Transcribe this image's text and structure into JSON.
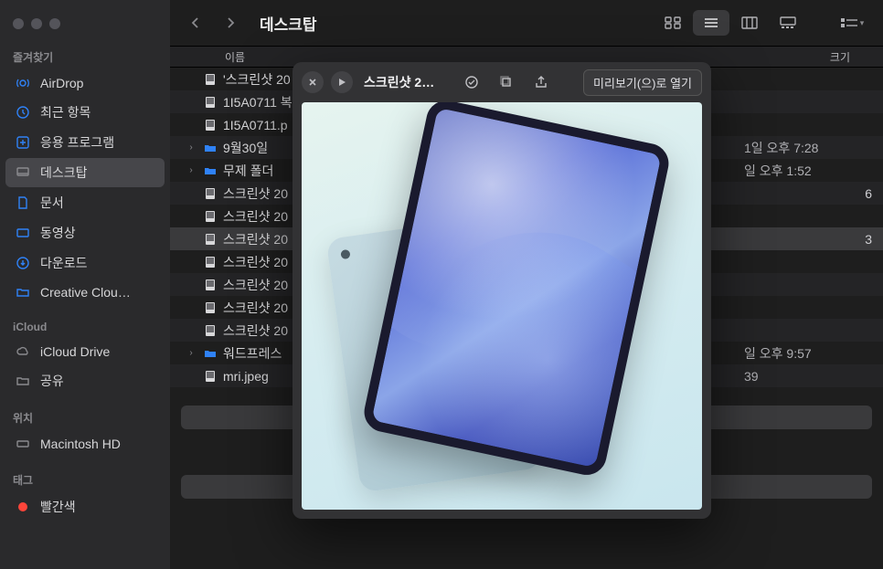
{
  "window_title": "데스크탑",
  "sidebar": {
    "sections": {
      "favorites_label": "즐겨찾기",
      "icloud_label": "iCloud",
      "locations_label": "위치",
      "tags_label": "태그"
    },
    "favorites": [
      {
        "label": "AirDrop"
      },
      {
        "label": "최근 항목"
      },
      {
        "label": "응용 프로그램"
      },
      {
        "label": "데스크탑"
      },
      {
        "label": "문서"
      },
      {
        "label": "동영상"
      },
      {
        "label": "다운로드"
      },
      {
        "label": "Creative Clou…"
      }
    ],
    "icloud": [
      {
        "label": "iCloud Drive"
      },
      {
        "label": "공유"
      }
    ],
    "locations": [
      {
        "label": "Macintosh HD"
      }
    ],
    "tags": [
      {
        "label": "빨간색"
      }
    ]
  },
  "columns": {
    "name": "이름",
    "size": "크기"
  },
  "files": [
    {
      "name": "'스크린샷 20",
      "date_fragment": "",
      "size_fragment": ""
    },
    {
      "name": "1I5A0711 복",
      "date_fragment": "",
      "size_fragment": ""
    },
    {
      "name": "1I5A0711.p",
      "date_fragment": "",
      "size_fragment": ""
    },
    {
      "name": "9월30일",
      "folder": true,
      "disclosure": true,
      "date_fragment": "1일 오후 7:28",
      "size_fragment": ""
    },
    {
      "name": "무제 폴더",
      "folder": true,
      "disclosure": true,
      "date_fragment": "일 오후 1:52",
      "size_fragment": ""
    },
    {
      "name": "스크린샷 20",
      "date_fragment": "",
      "size_fragment": "6"
    },
    {
      "name": "스크린샷 20",
      "date_fragment": "",
      "size_fragment": ""
    },
    {
      "name": "스크린샷 20",
      "date_fragment": "",
      "size_fragment": "3",
      "selected": true
    },
    {
      "name": "스크린샷 20",
      "date_fragment": "",
      "size_fragment": ""
    },
    {
      "name": "스크린샷 20",
      "date_fragment": "",
      "size_fragment": ""
    },
    {
      "name": "스크린샷 20",
      "date_fragment": "",
      "size_fragment": ""
    },
    {
      "name": "스크린샷 20",
      "date_fragment": "",
      "size_fragment": ""
    },
    {
      "name": "워드프레스",
      "folder": true,
      "disclosure": true,
      "date_fragment": "일 오후 9:57",
      "size_fragment": ""
    },
    {
      "name": "mri.jpeg",
      "date_fragment": "39",
      "size_fragment": ""
    }
  ],
  "quicklook": {
    "title": "스크린샷 2…",
    "open_button": "미리보기(으)로 열기"
  }
}
